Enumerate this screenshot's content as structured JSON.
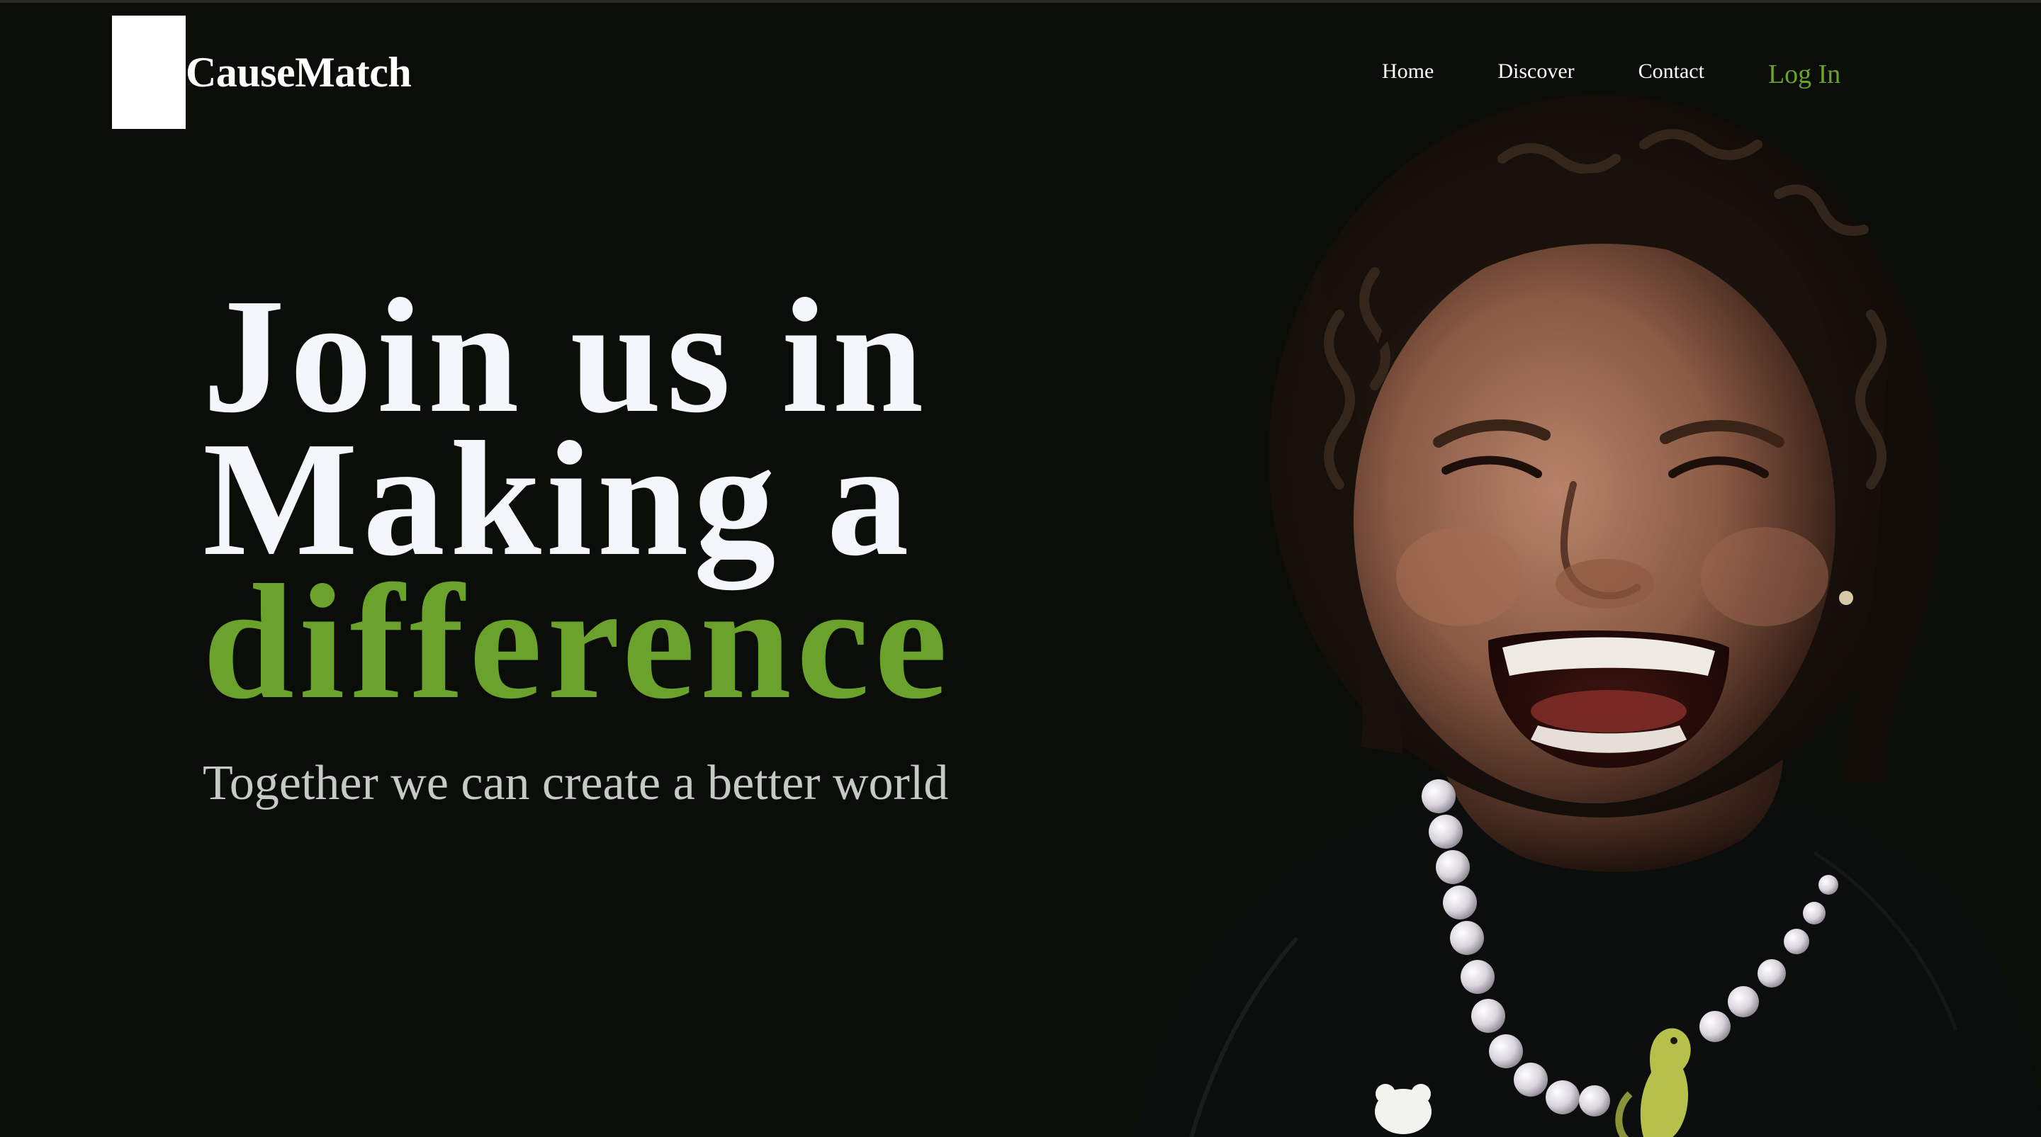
{
  "header": {
    "brand": "CauseMatch",
    "nav": {
      "home": "Home",
      "discover": "Discover",
      "contact": "Contact",
      "login": "Log In"
    }
  },
  "hero": {
    "headline_line1": "Join us in",
    "headline_line2": "Making a",
    "headline_accent": "difference",
    "subtitle": "Together we can create a better world"
  },
  "image": {
    "subject": "laughing-child-photo"
  },
  "colors": {
    "background": "#0b0d08",
    "accent": "#6aa22c",
    "headline": "#f3f6fb",
    "subtitle": "#c7c9c5"
  }
}
